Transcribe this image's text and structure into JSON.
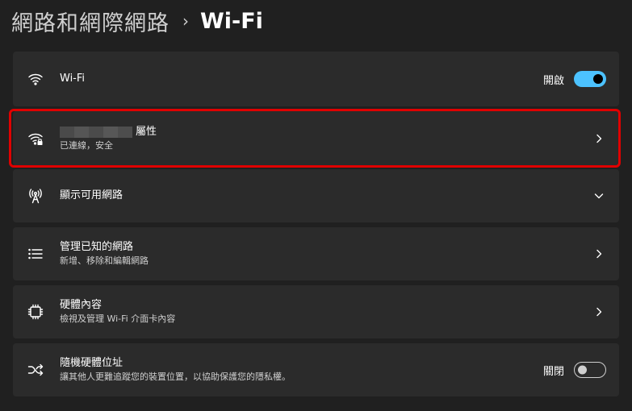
{
  "breadcrumb": {
    "parent": "網路和網際網路",
    "separator": "›",
    "current": "Wi-Fi"
  },
  "cards": {
    "wifi": {
      "title": "Wi-Fi",
      "toggle_label": "開啟",
      "toggle_on": true,
      "icon": "wifi-icon"
    },
    "properties": {
      "title_suffix": "屬性",
      "subtitle": "已連線，安全",
      "icon": "wifi-lock-icon"
    },
    "available": {
      "title": "顯示可用網路",
      "icon": "antenna-icon"
    },
    "manage": {
      "title": "管理已知的網路",
      "subtitle": "新增、移除和編輯網路",
      "icon": "list-icon"
    },
    "hardware": {
      "title": "硬體內容",
      "subtitle": "檢視及管理 Wi-Fi 介面卡內容",
      "icon": "chip-icon"
    },
    "random": {
      "title": "隨機硬體位址",
      "subtitle": "讓其他人更難追蹤您的裝置位置，以協助保護您的隱私權。",
      "toggle_label": "關閉",
      "toggle_on": false,
      "icon": "shuffle-icon"
    }
  },
  "colors": {
    "background": "#202020",
    "card": "#2b2b2b",
    "accent": "#4cc2ff",
    "highlight": "#e00000"
  }
}
